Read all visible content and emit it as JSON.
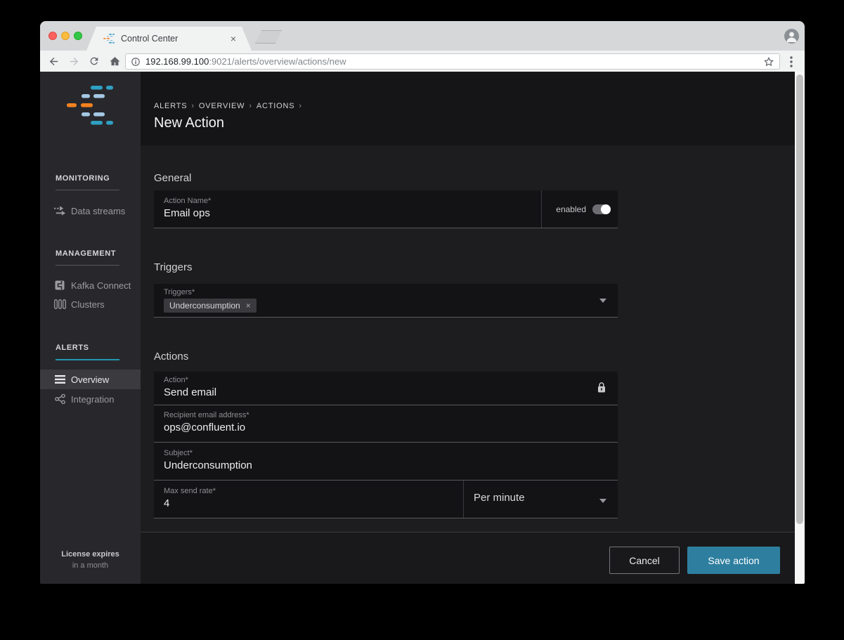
{
  "browser": {
    "tab": {
      "title": "Control Center",
      "close_glyph": "×"
    },
    "url": {
      "host": "192.168.99.100",
      "path": ":9021/alerts/overview/actions/new"
    }
  },
  "sidebar": {
    "sections": [
      {
        "header": "MONITORING",
        "items": [
          {
            "label": "Data streams"
          }
        ]
      },
      {
        "header": "MANAGEMENT",
        "items": [
          {
            "label": "Kafka Connect"
          },
          {
            "label": "Clusters"
          }
        ]
      },
      {
        "header": "ALERTS",
        "items": [
          {
            "label": "Overview",
            "active": true
          },
          {
            "label": "Integration"
          }
        ]
      }
    ],
    "license": {
      "line1": "License expires",
      "line2": "in a month"
    }
  },
  "main": {
    "breadcrumb": {
      "items": [
        "ALERTS",
        "OVERVIEW",
        "ACTIONS"
      ],
      "separator": "›"
    },
    "title": "New Action",
    "general": {
      "heading": "General",
      "field": {
        "label": "Action Name*",
        "value": "Email ops"
      },
      "toggle": {
        "label": "enabled",
        "state": "on"
      }
    },
    "triggers": {
      "heading": "Triggers",
      "field": {
        "label": "Triggers*",
        "chip": "Underconsumption",
        "chip_close": "×"
      }
    },
    "actions": {
      "heading": "Actions",
      "fields": [
        {
          "label": "Action*",
          "value": "Send email",
          "locked": true
        },
        {
          "label": "Recipient email address*",
          "value": "ops@confluent.io"
        },
        {
          "label": "Subject*",
          "value": "Underconsumption"
        },
        {
          "label": "Max send rate*",
          "value": "4",
          "unit": "Per minute"
        }
      ]
    },
    "footer": {
      "cancel": "Cancel",
      "save": "Save action"
    }
  },
  "colors": {
    "accent_teal": "#2396b2",
    "save_button": "#2e7f9f",
    "logo_teal": "#2f9fc2",
    "logo_light_blue": "#a5c8e4",
    "logo_orange": "#f5821f",
    "sidebar_bg": "#28282c",
    "panel_bg": "#131316",
    "header_bg": "#151517"
  }
}
